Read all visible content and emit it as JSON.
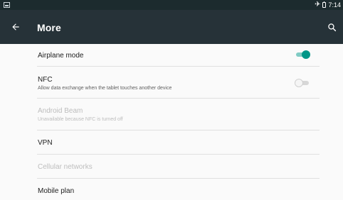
{
  "status_bar": {
    "time": "7:14",
    "icons": [
      "screenshot-icon",
      "airplane-icon",
      "battery-icon"
    ]
  },
  "app_bar": {
    "title": "More",
    "icons": [
      "back-arrow-icon",
      "search-icon"
    ]
  },
  "settings": [
    {
      "title": "Airplane mode",
      "summary": "",
      "toggle": "on",
      "enabled": true
    },
    {
      "title": "NFC",
      "summary": "Allow data exchange when the tablet touches another device",
      "toggle": "off",
      "enabled": true
    },
    {
      "title": "Android Beam",
      "summary": "Unavailable because NFC is turned off",
      "enabled": false
    },
    {
      "title": "VPN",
      "summary": "",
      "enabled": true
    },
    {
      "title": "Cellular networks",
      "summary": "",
      "enabled": false
    },
    {
      "title": "Mobile plan",
      "summary": "",
      "enabled": true
    }
  ],
  "colors": {
    "app_bar": "#263238",
    "status_bar": "#1c2b2e",
    "accent": "#009688",
    "background": "#fafafa",
    "disabled_text": "#bdbdbd"
  }
}
